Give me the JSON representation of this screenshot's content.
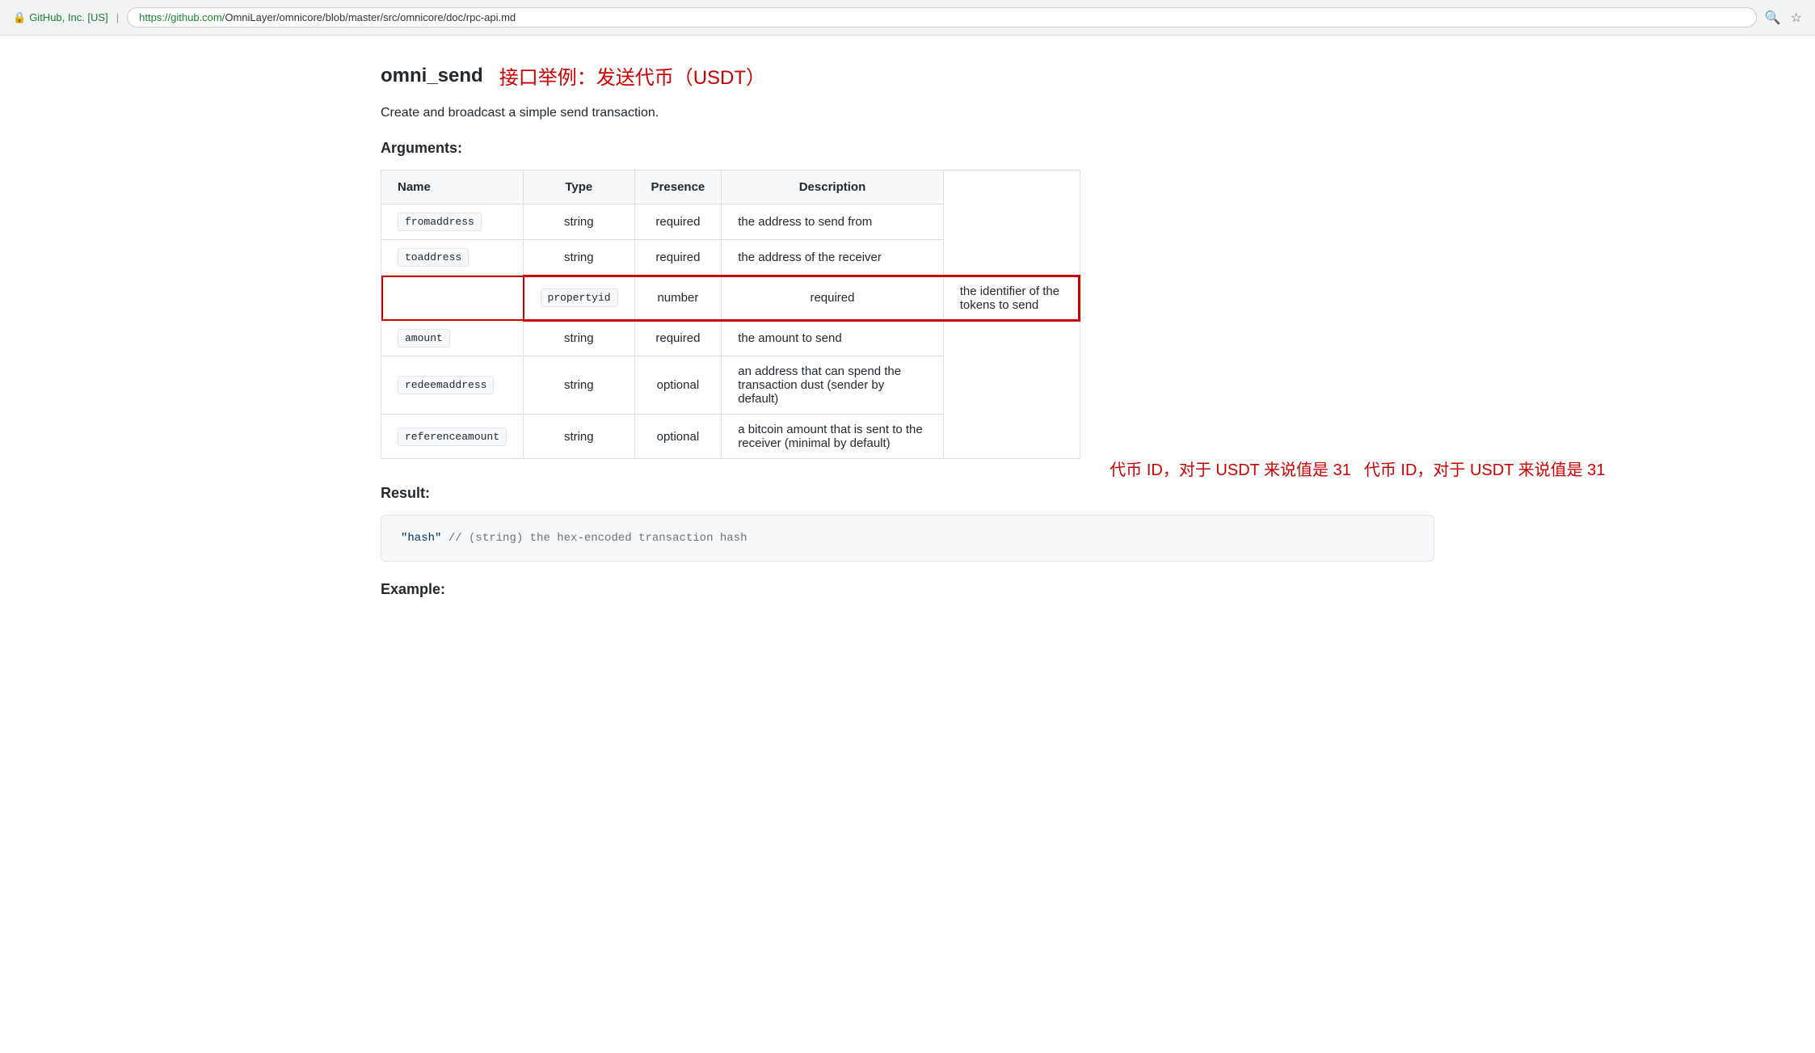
{
  "browser": {
    "security_org": "GitHub, Inc. [US]",
    "url_green": "https://github.com/",
    "url_rest": "OmniLayer/omnicore/blob/master/src/omnicore/doc/rpc-api.md"
  },
  "page": {
    "api_name": "omni_send",
    "api_subtitle": "接口举例：发送代币（USDT）",
    "description": "Create and broadcast a simple send transaction.",
    "arguments_title": "Arguments:",
    "result_title": "Result:",
    "example_title": "Example:"
  },
  "table": {
    "headers": [
      "Name",
      "Type",
      "Presence",
      "Description"
    ],
    "rows": [
      {
        "name": "fromaddress",
        "type": "string",
        "presence": "required",
        "description": "the address to send from",
        "highlighted": false
      },
      {
        "name": "toaddress",
        "type": "string",
        "presence": "required",
        "description": "the address of the receiver",
        "highlighted": false
      },
      {
        "name": "propertyid",
        "type": "number",
        "presence": "required",
        "description": "the identifier of the tokens to send",
        "highlighted": true,
        "annotation": "代币 ID，对于 USDT 来说值是 31"
      },
      {
        "name": "amount",
        "type": "string",
        "presence": "required",
        "description": "the amount to send",
        "highlighted": false
      },
      {
        "name": "redeemaddress",
        "type": "string",
        "presence": "optional",
        "description": "an address that can spend the transaction dust (sender by default)",
        "highlighted": false
      },
      {
        "name": "referenceamount",
        "type": "string",
        "presence": "optional",
        "description": "a bitcoin amount that is sent to the receiver (minimal by default)",
        "highlighted": false
      }
    ]
  },
  "result": {
    "code": "\"hash\"  // (string) the hex-encoded transaction hash"
  }
}
